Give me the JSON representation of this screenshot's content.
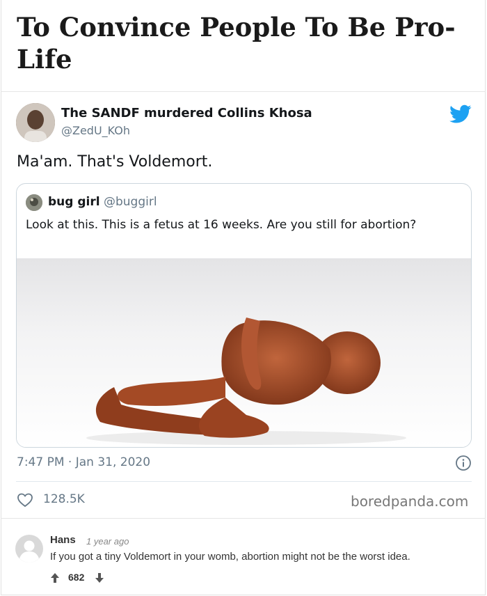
{
  "post": {
    "title": "To Convince People To Be Pro-Life"
  },
  "tweet": {
    "author_name": "The SANDF murdered Collins Khosa",
    "author_handle": "@ZedU_KOh",
    "text": "Ma'am. That's Voldemort.",
    "timestamp": "7:47 PM · Jan 31, 2020",
    "likes": "128.5K",
    "icons": [
      "twitter-bird-icon",
      "info-icon",
      "heart-icon"
    ],
    "accent_color": "#1da1f2"
  },
  "quoted_tweet": {
    "author_name": "bug girl",
    "author_handle": "@buggirl",
    "text": "Look at this. This is a fetus at 16 weeks. Are you still for abortion?"
  },
  "watermark": "boredpanda.com",
  "comment": {
    "author": "Hans",
    "time": "1 year ago",
    "text": "If you got a tiny Voldemort in your womb, abortion might not be the worst idea.",
    "votes": "682",
    "icons": [
      "upvote-icon",
      "downvote-icon",
      "user-avatar-icon"
    ]
  }
}
